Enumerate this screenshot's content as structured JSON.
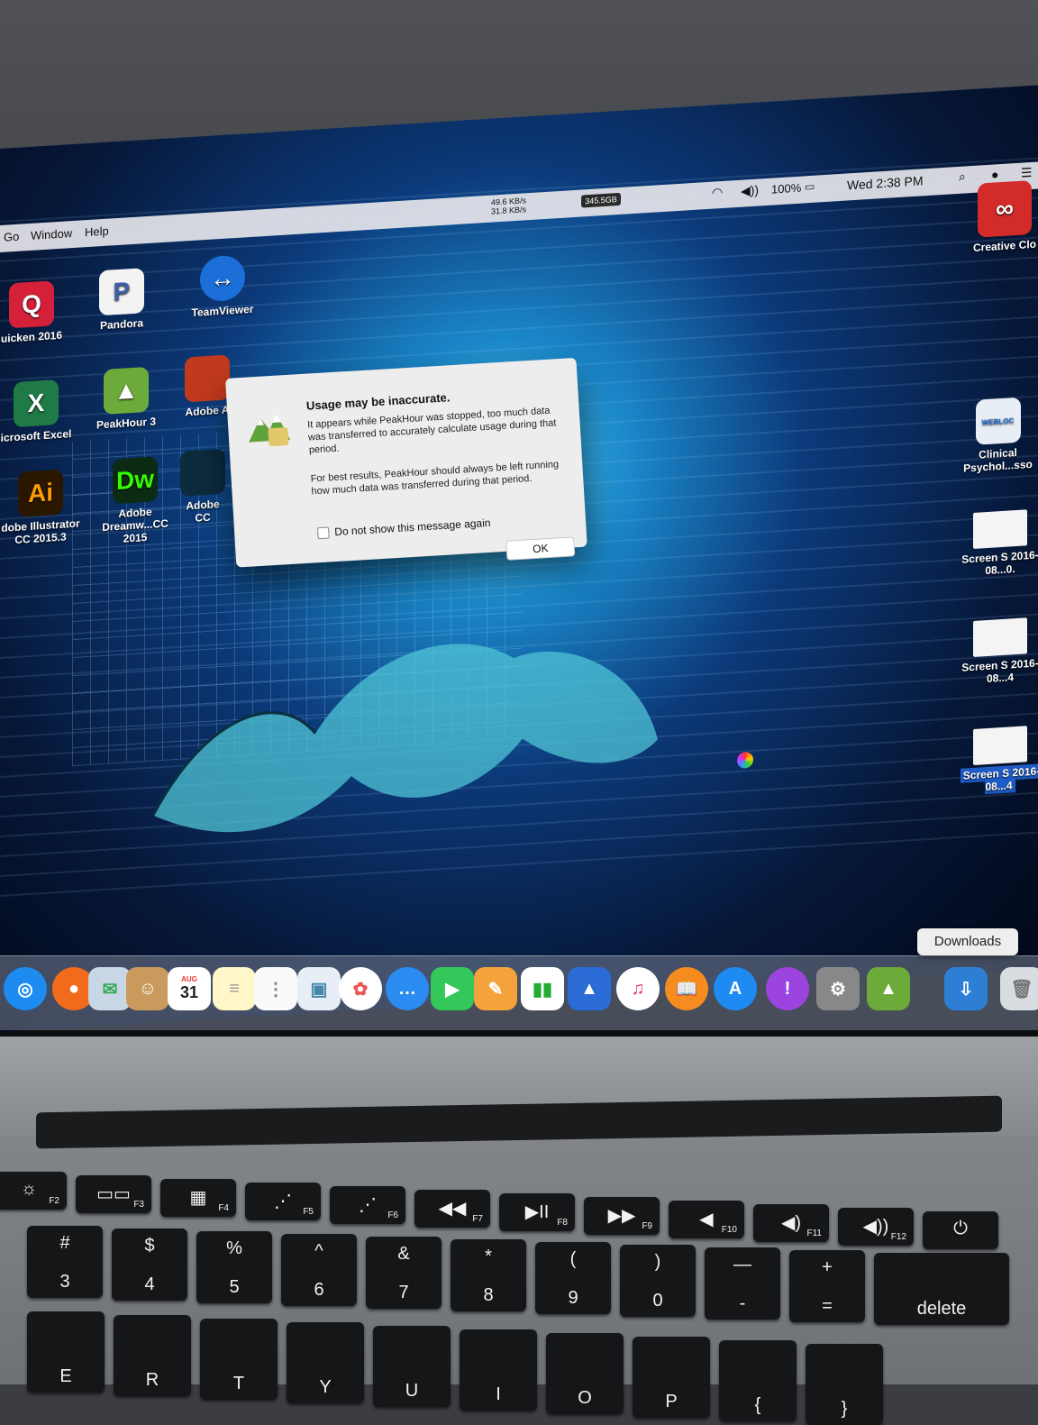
{
  "menu": {
    "left_items": [
      "Go",
      "Window",
      "Help"
    ],
    "net_up": "49.6 KB/s",
    "net_down": "31.8 KB/s",
    "usage_badge": "345.5GB",
    "battery": "100%",
    "clock": "Wed 2:38 PM"
  },
  "desktop_left": [
    {
      "label": "uicken 2016",
      "glyph": "Q",
      "color": "#d5203a"
    },
    {
      "label": "Pandora",
      "glyph": "P",
      "color": "#3f5fa8"
    },
    {
      "label": "TeamViewer",
      "glyph": "↔",
      "color": "#1c6fd8"
    },
    {
      "label": "icrosoft Excel",
      "glyph": "X",
      "color": "#1f7a45"
    },
    {
      "label": "PeakHour 3",
      "glyph": "▲",
      "color": "#6caa3a"
    },
    {
      "label": "Adobe A",
      "glyph": "",
      "color": "#c23a1d"
    },
    {
      "label": "dobe Illustrator CC 2015.3",
      "glyph": "Ai",
      "color": "#2b1700"
    },
    {
      "label": "Adobe Dreamw...CC 2015",
      "glyph": "Dw",
      "color": "#0d2a14"
    },
    {
      "label": "Adobe CC",
      "glyph": "",
      "color": "#0c2b3d"
    }
  ],
  "desktop_right": [
    {
      "label": "Creative Clo",
      "glyph": "∞",
      "color": "#d32a2a"
    },
    {
      "label": "Clinical Psychol...sso",
      "glyph": "WEBLOC",
      "color": "#e8eef5"
    },
    {
      "label": "Screen S 2016-08...0.",
      "glyph": "",
      "color": "#f4f4f4"
    },
    {
      "label": "Screen S 2016-08...4",
      "glyph": "",
      "color": "#f4f4f4"
    },
    {
      "label": "Screen S 2016-08...4",
      "glyph": "",
      "color": "#f4f4f4"
    }
  ],
  "alert": {
    "title": "Usage may be inaccurate.",
    "paragraph1": "It appears while PeakHour was stopped, too much data was transferred to accurately calculate usage during that period.",
    "paragraph2": "For best results, PeakHour should always be left running how much data was transferred during that period.",
    "checkbox_label": "Do not show this message again",
    "ok_label": "OK"
  },
  "dock": {
    "tooltip": "Downloads",
    "calendar_month": "AUG",
    "calendar_day": "31",
    "items": [
      "safari-icon",
      "firefox-icon",
      "mail-icon",
      "contacts-icon",
      "calendar-icon",
      "notes-icon",
      "reminders-icon",
      "preview-icon",
      "photos-icon",
      "messages-icon",
      "facetime-icon",
      "pages-icon",
      "numbers-icon",
      "keynote-icon",
      "itunes-icon",
      "ibooks-icon",
      "app-store-icon",
      "podcast-icon",
      "system-preferences-icon",
      "peakhour-icon",
      "downloads-icon",
      "trash-icon"
    ]
  },
  "keyboard": {
    "fn_row": [
      {
        "sym": "☼",
        "fn": "F2"
      },
      {
        "sym": "▭▭",
        "fn": "F3"
      },
      {
        "sym": "▦",
        "fn": "F4"
      },
      {
        "sym": "⋰",
        "fn": "F5"
      },
      {
        "sym": "⋰",
        "fn": "F6"
      },
      {
        "sym": "◀◀",
        "fn": "F7"
      },
      {
        "sym": "▶II",
        "fn": "F8"
      },
      {
        "sym": "▶▶",
        "fn": "F9"
      },
      {
        "sym": "◀",
        "fn": "F10"
      },
      {
        "sym": "◀)",
        "fn": "F11"
      },
      {
        "sym": "◀))",
        "fn": "F12"
      },
      {
        "sym": "⏻",
        "fn": ""
      }
    ],
    "num_row": [
      {
        "top": "#",
        "bottom": "3"
      },
      {
        "top": "$",
        "bottom": "4"
      },
      {
        "top": "%",
        "bottom": "5"
      },
      {
        "top": "^",
        "bottom": "6"
      },
      {
        "top": "&",
        "bottom": "7"
      },
      {
        "top": "*",
        "bottom": "8"
      },
      {
        "top": "(",
        "bottom": "9"
      },
      {
        "top": ")",
        "bottom": "0"
      },
      {
        "top": "—",
        "bottom": "-"
      },
      {
        "top": "+",
        "bottom": "="
      },
      {
        "top": "",
        "bottom": "delete"
      }
    ],
    "letter_row": [
      "E",
      "R",
      "T",
      "Y",
      "U",
      "I",
      "O",
      "P",
      "{",
      "}"
    ]
  }
}
